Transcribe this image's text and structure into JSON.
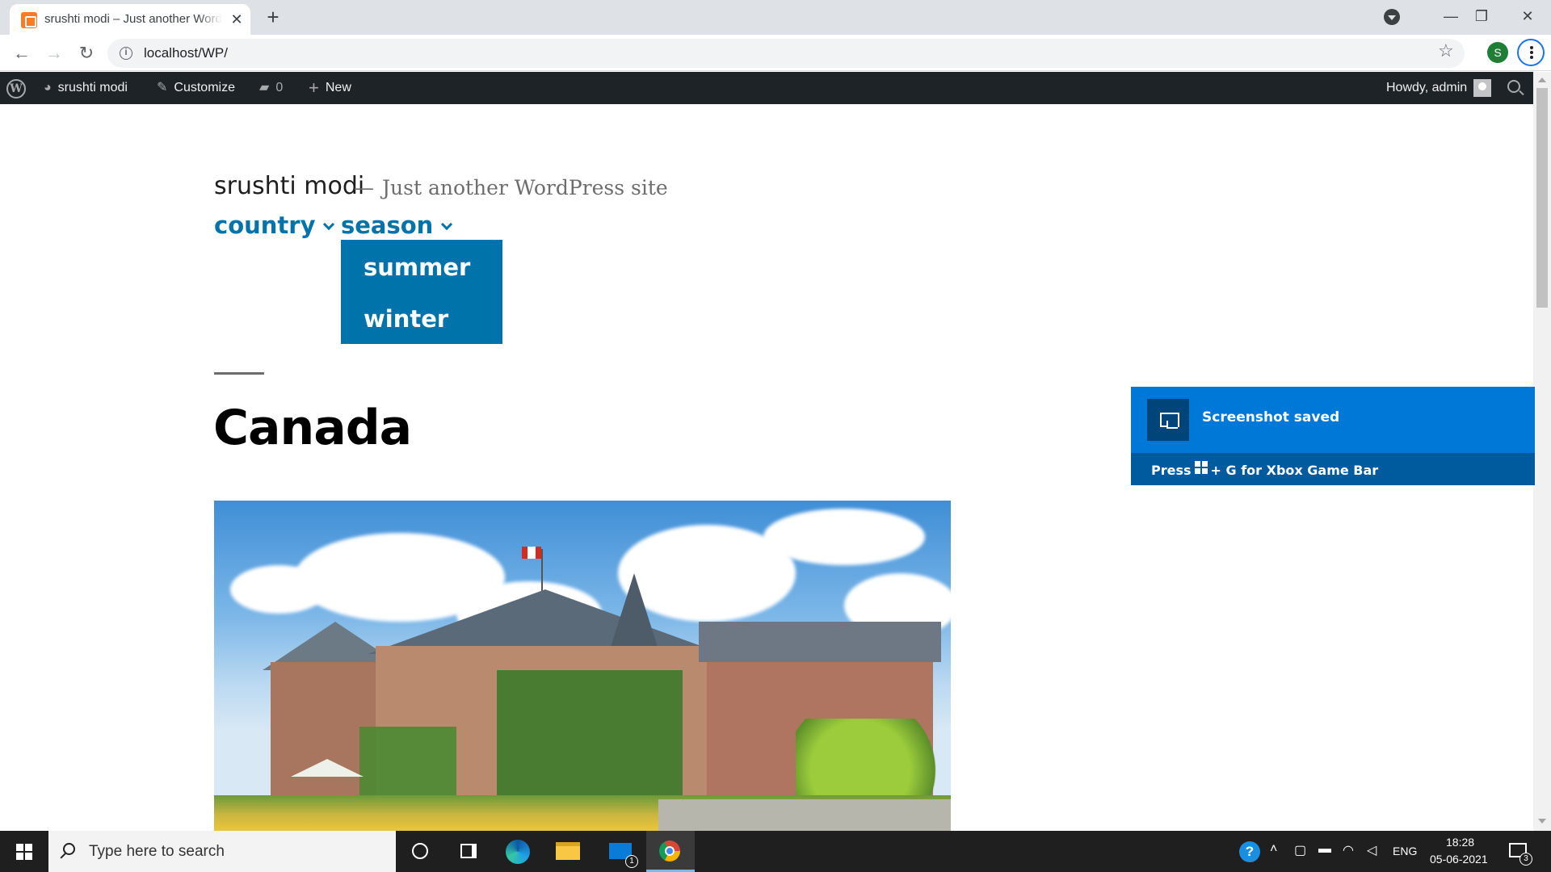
{
  "browser": {
    "tab_title": "srushti modi – Just another WordPress site",
    "url": "localhost/WP/",
    "profile_initial": "S",
    "window_controls": {
      "minimize": "—",
      "restore": "❐",
      "close": "✕"
    },
    "back": "←",
    "forward": "→",
    "reload": "↻",
    "new_tab": "+",
    "tab_close": "✕",
    "star": "☆",
    "info": "i"
  },
  "adminbar": {
    "wp_logo": "W",
    "site_name": "srushti modi",
    "customize": "Customize",
    "comments_count": "0",
    "new_label": "New",
    "howdy": "Howdy, admin"
  },
  "site": {
    "title": "srushti modi",
    "dash": "—",
    "description": "Just another WordPress site",
    "menu": {
      "country": "country",
      "season": "season",
      "season_submenu": [
        "summer",
        "winter"
      ]
    },
    "post_title": "Canada"
  },
  "toast": {
    "title": "Screenshot saved",
    "footer_prefix": "Press",
    "footer_suffix": "+ G for Xbox Game Bar"
  },
  "taskbar": {
    "search_placeholder": "Type here to search",
    "mail_badge": "1",
    "help": "?",
    "language": "ENG",
    "time": "18:28",
    "date": "05-06-2021",
    "notification_count": "3"
  },
  "colors": {
    "wp_link_blue": "#0073aa",
    "admin_bar": "#1d2327",
    "toast_blue": "#0078d7",
    "taskbar": "#1f1f1f"
  }
}
